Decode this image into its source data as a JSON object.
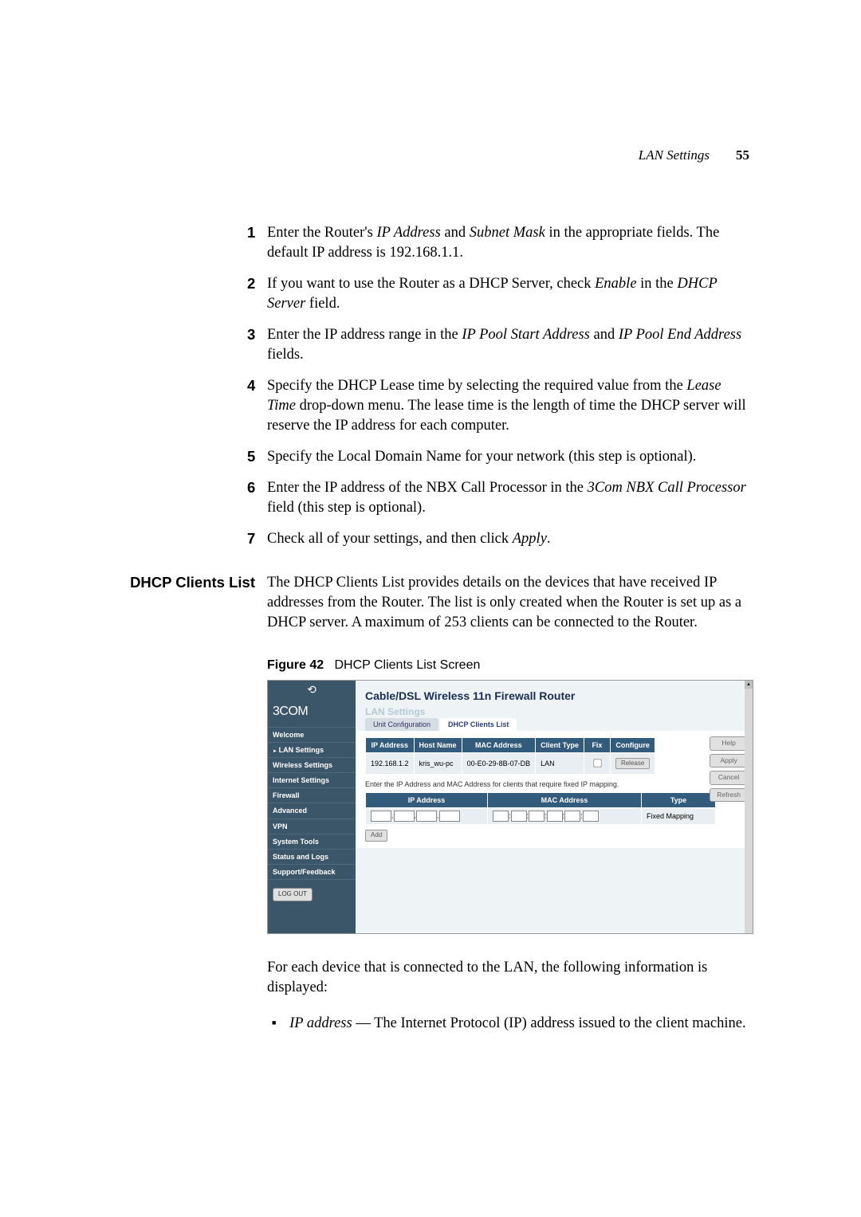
{
  "header": {
    "section": "LAN Settings",
    "page_number": "55"
  },
  "steps": [
    {
      "before": "Enter the Router's ",
      "em1": "IP Address",
      "mid1": " and ",
      "em2": "Subnet Mask",
      "after": " in the appropriate fields. The default IP address is 192.168.1.1."
    },
    {
      "before": "If you want to use the Router as a DHCP Server, check ",
      "em1": "Enable",
      "mid1": " in the ",
      "em2": "DHCP Server",
      "after": " field."
    },
    {
      "before": "Enter the IP address range in the ",
      "em1": "IP Pool Start Address",
      "mid1": " and ",
      "em2": "IP Pool End Address",
      "after": " fields."
    },
    {
      "before": "Specify the DHCP Lease time by selecting the required value from the ",
      "em1": "Lease Time",
      "after": " drop-down menu. The lease time is the length of time the DHCP server will reserve the IP address for each computer."
    },
    {
      "before": "Specify the Local Domain Name for your network (this step is optional)."
    },
    {
      "before": "Enter the IP address of the NBX Call Processor in the ",
      "em1": "3Com NBX Call Processor",
      "after": " field (this step is optional)."
    },
    {
      "before": "Check all of your settings, and then click ",
      "em1": "Apply",
      "after": "."
    }
  ],
  "side_heading": "DHCP Clients List",
  "intro_para": "The DHCP Clients List provides details on the devices that have received IP addresses from the Router. The list is only created when the Router is set up as a DHCP server. A maximum of 253 clients can be connected to the Router.",
  "figure": {
    "label": "Figure 42",
    "title": "DHCP Clients List Screen"
  },
  "after_figure_para": "For each device that is connected to the LAN, the following information is displayed:",
  "bullet": {
    "term": "IP address",
    "desc": " — The Internet Protocol (IP) address issued to the client machine."
  },
  "screenshot": {
    "brand_icon": "⟲",
    "brand": "3COM",
    "menu": [
      "Welcome",
      "LAN Settings",
      "Wireless Settings",
      "Internet Settings",
      "Firewall",
      "Advanced",
      "VPN",
      "System Tools",
      "Status and Logs",
      "Support/Feedback"
    ],
    "logout": "LOG OUT",
    "title": "Cable/DSL Wireless 11n Firewall Router",
    "subtitle": "LAN Settings",
    "tabs": [
      "Unit Configuration",
      "DHCP Clients List"
    ],
    "table1": {
      "headers": [
        "IP Address",
        "Host Name",
        "MAC Address",
        "Client Type",
        "Fix",
        "Configure"
      ],
      "row": [
        "192.168.1.2",
        "kris_wu-pc",
        "00-E0-29-8B-07-DB",
        "LAN"
      ],
      "release": "Release"
    },
    "hint": "Enter the IP Address and MAC Address for clients that require fixed IP mapping.",
    "table2": {
      "headers": [
        "IP Address",
        "MAC Address",
        "Type"
      ],
      "type_val": "Fixed Mapping",
      "add": "Add"
    },
    "buttons": [
      "Help",
      "Apply",
      "Cancel",
      "Refresh"
    ]
  }
}
